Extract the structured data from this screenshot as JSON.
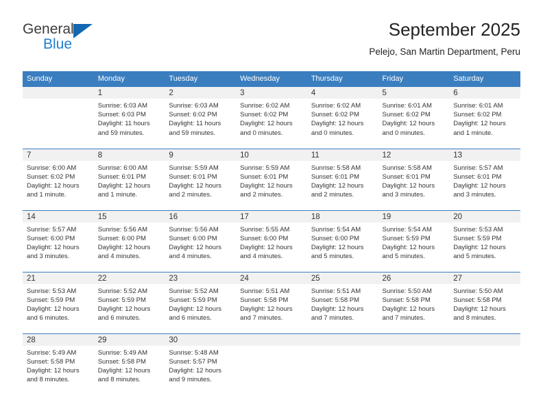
{
  "brand": {
    "name_top": "General",
    "name_bottom": "Blue",
    "accent_color": "#1268b3",
    "blue_text_color": "#1f7fd0"
  },
  "header": {
    "month_title": "September 2025",
    "location": "Pelejo, San Martin Department, Peru"
  },
  "calendar": {
    "header_bg": "#3a7ebf",
    "daynum_bg": "#f1f1f1",
    "weekday_headers": [
      "Sunday",
      "Monday",
      "Tuesday",
      "Wednesday",
      "Thursday",
      "Friday",
      "Saturday"
    ],
    "weeks": [
      [
        {
          "day": "",
          "sunrise": "",
          "sunset": "",
          "daylight": "",
          "blank": true
        },
        {
          "day": "1",
          "sunrise": "Sunrise: 6:03 AM",
          "sunset": "Sunset: 6:03 PM",
          "daylight": "Daylight: 11 hours and 59 minutes."
        },
        {
          "day": "2",
          "sunrise": "Sunrise: 6:03 AM",
          "sunset": "Sunset: 6:02 PM",
          "daylight": "Daylight: 11 hours and 59 minutes."
        },
        {
          "day": "3",
          "sunrise": "Sunrise: 6:02 AM",
          "sunset": "Sunset: 6:02 PM",
          "daylight": "Daylight: 12 hours and 0 minutes."
        },
        {
          "day": "4",
          "sunrise": "Sunrise: 6:02 AM",
          "sunset": "Sunset: 6:02 PM",
          "daylight": "Daylight: 12 hours and 0 minutes."
        },
        {
          "day": "5",
          "sunrise": "Sunrise: 6:01 AM",
          "sunset": "Sunset: 6:02 PM",
          "daylight": "Daylight: 12 hours and 0 minutes."
        },
        {
          "day": "6",
          "sunrise": "Sunrise: 6:01 AM",
          "sunset": "Sunset: 6:02 PM",
          "daylight": "Daylight: 12 hours and 1 minute."
        }
      ],
      [
        {
          "day": "7",
          "sunrise": "Sunrise: 6:00 AM",
          "sunset": "Sunset: 6:02 PM",
          "daylight": "Daylight: 12 hours and 1 minute."
        },
        {
          "day": "8",
          "sunrise": "Sunrise: 6:00 AM",
          "sunset": "Sunset: 6:01 PM",
          "daylight": "Daylight: 12 hours and 1 minute."
        },
        {
          "day": "9",
          "sunrise": "Sunrise: 5:59 AM",
          "sunset": "Sunset: 6:01 PM",
          "daylight": "Daylight: 12 hours and 2 minutes."
        },
        {
          "day": "10",
          "sunrise": "Sunrise: 5:59 AM",
          "sunset": "Sunset: 6:01 PM",
          "daylight": "Daylight: 12 hours and 2 minutes."
        },
        {
          "day": "11",
          "sunrise": "Sunrise: 5:58 AM",
          "sunset": "Sunset: 6:01 PM",
          "daylight": "Daylight: 12 hours and 2 minutes."
        },
        {
          "day": "12",
          "sunrise": "Sunrise: 5:58 AM",
          "sunset": "Sunset: 6:01 PM",
          "daylight": "Daylight: 12 hours and 3 minutes."
        },
        {
          "day": "13",
          "sunrise": "Sunrise: 5:57 AM",
          "sunset": "Sunset: 6:01 PM",
          "daylight": "Daylight: 12 hours and 3 minutes."
        }
      ],
      [
        {
          "day": "14",
          "sunrise": "Sunrise: 5:57 AM",
          "sunset": "Sunset: 6:00 PM",
          "daylight": "Daylight: 12 hours and 3 minutes."
        },
        {
          "day": "15",
          "sunrise": "Sunrise: 5:56 AM",
          "sunset": "Sunset: 6:00 PM",
          "daylight": "Daylight: 12 hours and 4 minutes."
        },
        {
          "day": "16",
          "sunrise": "Sunrise: 5:56 AM",
          "sunset": "Sunset: 6:00 PM",
          "daylight": "Daylight: 12 hours and 4 minutes."
        },
        {
          "day": "17",
          "sunrise": "Sunrise: 5:55 AM",
          "sunset": "Sunset: 6:00 PM",
          "daylight": "Daylight: 12 hours and 4 minutes."
        },
        {
          "day": "18",
          "sunrise": "Sunrise: 5:54 AM",
          "sunset": "Sunset: 6:00 PM",
          "daylight": "Daylight: 12 hours and 5 minutes."
        },
        {
          "day": "19",
          "sunrise": "Sunrise: 5:54 AM",
          "sunset": "Sunset: 5:59 PM",
          "daylight": "Daylight: 12 hours and 5 minutes."
        },
        {
          "day": "20",
          "sunrise": "Sunrise: 5:53 AM",
          "sunset": "Sunset: 5:59 PM",
          "daylight": "Daylight: 12 hours and 5 minutes."
        }
      ],
      [
        {
          "day": "21",
          "sunrise": "Sunrise: 5:53 AM",
          "sunset": "Sunset: 5:59 PM",
          "daylight": "Daylight: 12 hours and 6 minutes."
        },
        {
          "day": "22",
          "sunrise": "Sunrise: 5:52 AM",
          "sunset": "Sunset: 5:59 PM",
          "daylight": "Daylight: 12 hours and 6 minutes."
        },
        {
          "day": "23",
          "sunrise": "Sunrise: 5:52 AM",
          "sunset": "Sunset: 5:59 PM",
          "daylight": "Daylight: 12 hours and 6 minutes."
        },
        {
          "day": "24",
          "sunrise": "Sunrise: 5:51 AM",
          "sunset": "Sunset: 5:58 PM",
          "daylight": "Daylight: 12 hours and 7 minutes."
        },
        {
          "day": "25",
          "sunrise": "Sunrise: 5:51 AM",
          "sunset": "Sunset: 5:58 PM",
          "daylight": "Daylight: 12 hours and 7 minutes."
        },
        {
          "day": "26",
          "sunrise": "Sunrise: 5:50 AM",
          "sunset": "Sunset: 5:58 PM",
          "daylight": "Daylight: 12 hours and 7 minutes."
        },
        {
          "day": "27",
          "sunrise": "Sunrise: 5:50 AM",
          "sunset": "Sunset: 5:58 PM",
          "daylight": "Daylight: 12 hours and 8 minutes."
        }
      ],
      [
        {
          "day": "28",
          "sunrise": "Sunrise: 5:49 AM",
          "sunset": "Sunset: 5:58 PM",
          "daylight": "Daylight: 12 hours and 8 minutes."
        },
        {
          "day": "29",
          "sunrise": "Sunrise: 5:49 AM",
          "sunset": "Sunset: 5:58 PM",
          "daylight": "Daylight: 12 hours and 8 minutes."
        },
        {
          "day": "30",
          "sunrise": "Sunrise: 5:48 AM",
          "sunset": "Sunset: 5:57 PM",
          "daylight": "Daylight: 12 hours and 9 minutes."
        },
        {
          "day": "",
          "sunrise": "",
          "sunset": "",
          "daylight": "",
          "blank": true
        },
        {
          "day": "",
          "sunrise": "",
          "sunset": "",
          "daylight": "",
          "blank": true
        },
        {
          "day": "",
          "sunrise": "",
          "sunset": "",
          "daylight": "",
          "blank": true
        },
        {
          "day": "",
          "sunrise": "",
          "sunset": "",
          "daylight": "",
          "blank": true
        }
      ]
    ]
  }
}
